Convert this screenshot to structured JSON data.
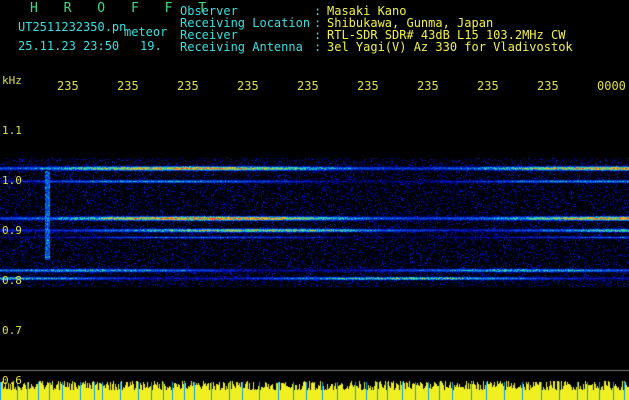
{
  "header": {
    "title": "H R O F F T",
    "filename": "UT2511232350.pn",
    "file_suffix": "meteor",
    "datetime": "25.11.23 23:50",
    "index": "19.",
    "labels": [
      "Observer",
      "Receiving Location",
      "Receiver",
      "Receiving Antenna"
    ],
    "separators": [
      ":",
      ":",
      ":",
      ":"
    ],
    "values": [
      "Masaki Kano",
      "Shibukawa, Gunma, Japan",
      "RTL-SDR SDR# 43dB L15 103.2MHz CW",
      "3el Yagi(V) Az 330 for Vladivostok"
    ]
  },
  "axis": {
    "unit": "kHz",
    "y_ticks": [
      "1.1",
      "1.0",
      "0.9",
      "0.8",
      "0.7",
      "0.6"
    ],
    "time_ticks": [
      "235",
      "235",
      "235",
      "235",
      "235",
      "235",
      "235",
      "235",
      "235",
      "0000"
    ]
  },
  "colors": {
    "background": "#000000",
    "header_title": "#3ddc84",
    "header_label": "#35e0e0",
    "axis_text": "#e0e040",
    "noise_floor": "#f0f020"
  }
}
